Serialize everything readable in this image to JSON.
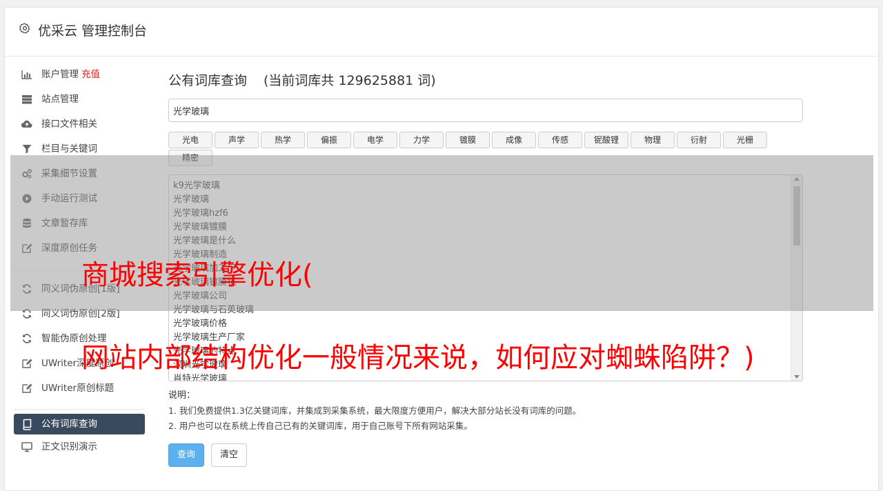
{
  "app": {
    "title": "优采云 管理控制台",
    "icon": "gear-icon"
  },
  "sidebar": {
    "items": [
      {
        "label": "账户管理",
        "badge": "充值",
        "icon": "bar-chart-icon"
      },
      {
        "label": "站点管理",
        "icon": "server-icon"
      },
      {
        "label": "接口文件相关",
        "icon": "cloud-upload-icon"
      },
      {
        "label": "栏目与关键词",
        "icon": "filter-icon"
      },
      {
        "label": "采集细节设置",
        "icon": "cogs-icon"
      },
      {
        "label": "手动运行测试",
        "icon": "play-circle-icon"
      },
      {
        "label": "文章暂存库",
        "icon": "database-icon"
      },
      {
        "label": "深度原创任务",
        "icon": "edit-icon"
      }
    ],
    "items2": [
      {
        "label": "同义词伪原创[1版]",
        "icon": "refresh-icon"
      },
      {
        "label": "同义词伪原创[2版]",
        "icon": "refresh-icon"
      },
      {
        "label": "智能伪原创处理",
        "icon": "refresh-icon"
      },
      {
        "label": "UWriter深度原创",
        "icon": "edit-icon"
      },
      {
        "label": "UWriter原创标题",
        "icon": "edit-icon"
      }
    ],
    "items3": [
      {
        "label": "公有词库查询",
        "icon": "book-icon",
        "active": true
      },
      {
        "label": "正文识别演示",
        "icon": "monitor-icon"
      }
    ]
  },
  "main": {
    "title": "公有词库查询",
    "count_text": "(当前词库共 129625881 词)",
    "search_value": "光学玻璃",
    "tags": [
      "光电",
      "声学",
      "热学",
      "偏振",
      "电学",
      "力学",
      "镀膜",
      "成像",
      "传感",
      "铌酸锂",
      "物理",
      "衍射",
      "光栅",
      "精密"
    ],
    "results": [
      "k9光学玻璃",
      "光学玻璃",
      "光学玻璃hzf6",
      "光学玻璃镀膜",
      "光学玻璃是什么",
      "光学玻璃制造",
      "光学玻璃加工厂",
      "光学玻璃镀膜机",
      "光学玻璃公司",
      "光学玻璃与石英玻璃",
      "光学玻璃价格",
      "光学玻璃生产厂家",
      "光学玻璃的特点",
      "深圳光学玻璃",
      "肖特光学玻璃"
    ],
    "desc_title": "说明：",
    "desc_lines": [
      "1. 我们免费提供1.3亿关键词库，并集成到采集系统，最大限度方便用户，解决大部分站长没有词库的问题。",
      "2. 用户也可以在系统上传自己已有的关键词库，用于自己账号下所有网站采集。"
    ],
    "query_button": "查询",
    "clear_button": "清空"
  },
  "overlay": {
    "line1": "商城搜索引擎优化(",
    "line2": "网站内部结构优化一般情况来说，如何应对蜘蛛陷阱？)"
  },
  "colors": {
    "active_nav": "#394a5f",
    "charge": "#e0201a",
    "primary": "#5bb1ee",
    "overlay_text": "#ff0000"
  }
}
